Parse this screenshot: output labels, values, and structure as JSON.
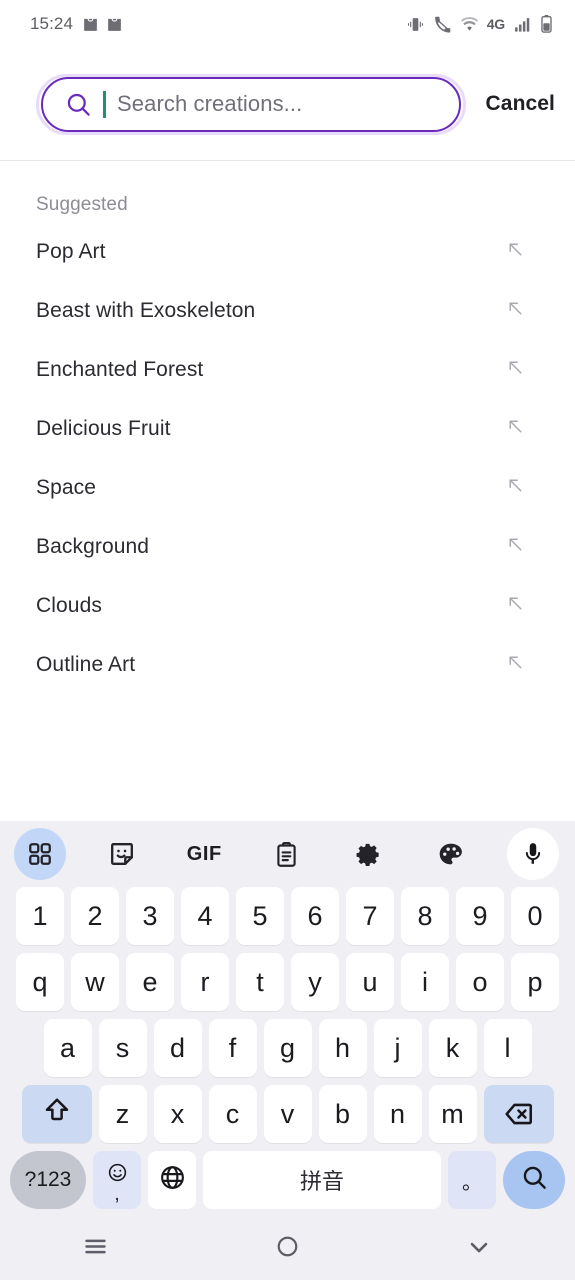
{
  "status_bar": {
    "time": "15:24",
    "notification_icons": [
      "shopping-bag-notification",
      "shopping-bag-notification"
    ],
    "right_icons": [
      "vibrate-icon",
      "call-mute-icon",
      "wifi-icon",
      "signal-bars-icon",
      "battery-icon"
    ],
    "network_label": "4G",
    "text_color": "#5d5d63"
  },
  "search_header": {
    "placeholder": "Search creations...",
    "value": "",
    "cancel_label": "Cancel",
    "border_color": "#6a2bbd",
    "halo_color": "#e8dcfa",
    "caret_color": "#1f8f76",
    "icon": "search-icon"
  },
  "suggestions": {
    "section_title": "Suggested",
    "trailing_icon": "arrow-up-left-icon",
    "items": [
      {
        "label": "Pop Art"
      },
      {
        "label": "Beast with Exoskeleton"
      },
      {
        "label": "Enchanted Forest"
      },
      {
        "label": "Delicious Fruit"
      },
      {
        "label": "Space"
      },
      {
        "label": "Background"
      },
      {
        "label": "Clouds"
      },
      {
        "label": "Outline Art"
      }
    ]
  },
  "keyboard": {
    "background": "#f0f0f4",
    "toolbar": [
      {
        "name": "grid-icon",
        "label": "",
        "active": true
      },
      {
        "name": "sticker-icon",
        "label": "",
        "active": false
      },
      {
        "name": "gif-icon",
        "label": "GIF",
        "active": false
      },
      {
        "name": "clipboard-icon",
        "label": "",
        "active": false
      },
      {
        "name": "gear-icon",
        "label": "",
        "active": false
      },
      {
        "name": "palette-icon",
        "label": "",
        "active": false
      },
      {
        "name": "microphone-icon",
        "label": "",
        "active": false
      }
    ],
    "row_numbers": [
      "1",
      "2",
      "3",
      "4",
      "5",
      "6",
      "7",
      "8",
      "9",
      "0"
    ],
    "row_top": [
      "q",
      "w",
      "e",
      "r",
      "t",
      "y",
      "u",
      "i",
      "o",
      "p"
    ],
    "row_home": [
      "a",
      "s",
      "d",
      "f",
      "g",
      "h",
      "j",
      "k",
      "l"
    ],
    "row_bottom": [
      "z",
      "x",
      "c",
      "v",
      "b",
      "n",
      "m"
    ],
    "shift_key": "shift-icon",
    "backspace_key": "backspace-icon",
    "symbols_key": "?123",
    "emoji_key": "emoji-icon",
    "comma_key": ",",
    "language_key": "globe-icon",
    "space_key": "拼音",
    "period_key": "。",
    "enter_key": "search-icon",
    "accent_key_color": "#ccd9f3",
    "enter_key_color": "#a8c4f0"
  },
  "nav_bar": {
    "buttons": [
      {
        "name": "recents-button",
        "icon": "hamburger-icon"
      },
      {
        "name": "home-button",
        "icon": "circle-icon"
      },
      {
        "name": "hide-keyboard-button",
        "icon": "chevron-down-icon"
      }
    ]
  }
}
